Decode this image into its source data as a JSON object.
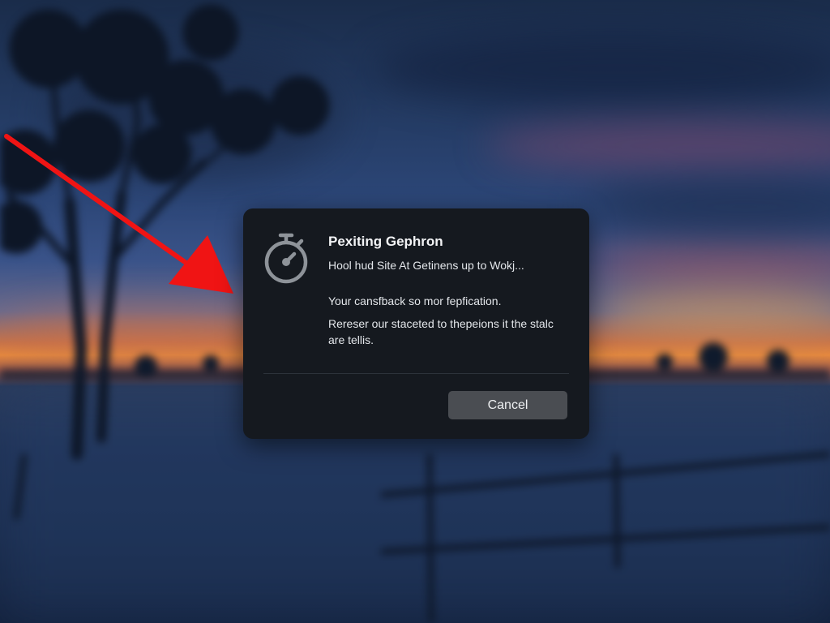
{
  "background": {
    "description_tag": "blurred-winter-sunset-backdrop",
    "colors": {
      "sky_top": "#1a2c4a",
      "sky_mid": "#2c4677",
      "horizon_glow": "#e98a3e",
      "ground": "#1f3256"
    }
  },
  "annotation": {
    "arrow_color": "#f01414",
    "icon": "red-arrow-icon"
  },
  "dialog": {
    "icon": "stopwatch-icon",
    "title": "Pexiting Gephron",
    "subtitle": "Hool hud Site At Getinens up to Wokj...",
    "body": "Your cansfback so mor fepfication.",
    "note": "Rereser our staceted to thepeions it the stalc are tellis.",
    "cancel_label": "Cancel",
    "colors": {
      "panel": "#15191f",
      "button": "#4a4d52",
      "text": "#e3e6ea"
    }
  }
}
